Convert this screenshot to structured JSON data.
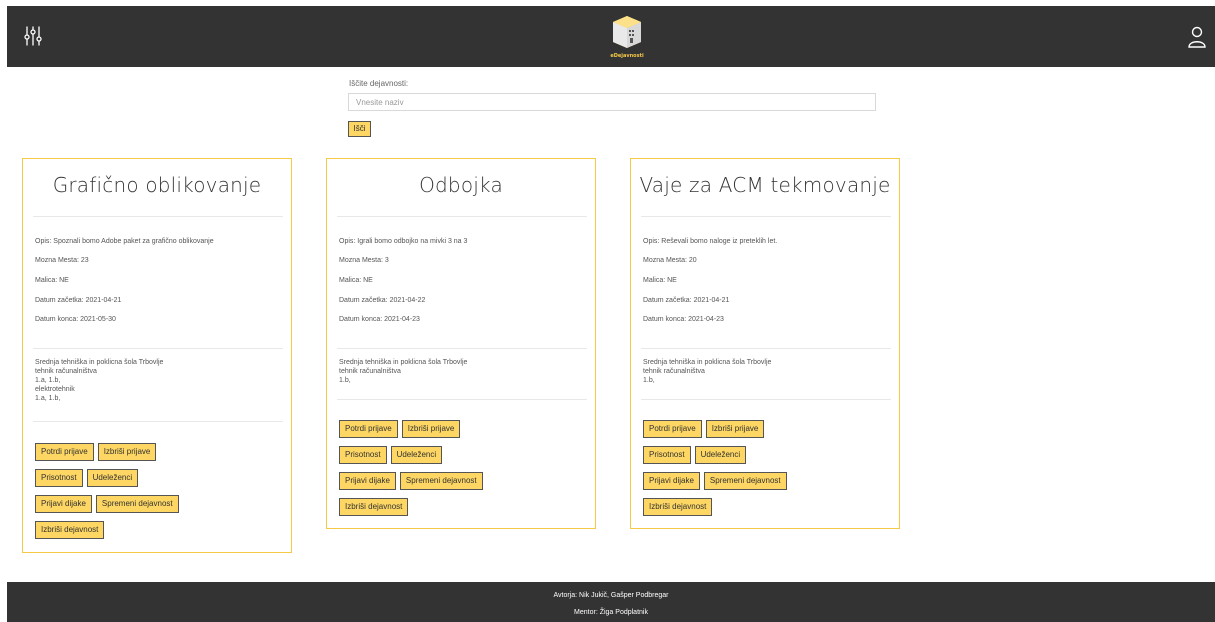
{
  "header": {
    "logo_text": "eDejavnosti",
    "colors": {
      "bar": "#333333",
      "accent": "#f7c948"
    },
    "icons": {
      "left": "sliders-icon",
      "right": "user-icon"
    }
  },
  "search": {
    "label": "Iščite dejavnosti:",
    "placeholder": "Vnesite naziv",
    "button": "Išči"
  },
  "cards": [
    {
      "title": "Grafično oblikovanje",
      "opis": "Opis: Spoznali bomo Adobe paket za grafično oblikovanje",
      "mesta": "Mozna Mesta: 23",
      "malica": "Malica: NE",
      "zacetek": "Datum začetka: 2021-04-21",
      "konec": "Datum konca: 2021-05-30",
      "school": [
        "Srednja tehniška in poklicna šola Trbovlje",
        "tehnik računalništva",
        "1.a, 1.b,",
        "elektrotehnik",
        "1.a, 1.b,"
      ]
    },
    {
      "title": "Odbojka",
      "opis": "Opis: Igrali bomo odbojko na mivki 3 na 3",
      "mesta": "Mozna Mesta: 3",
      "malica": "Malica: NE",
      "zacetek": "Datum začetka: 2021-04-22",
      "konec": "Datum konca: 2021-04-23",
      "school": [
        "Srednja tehniška in poklicna šola Trbovlje",
        "tehnik računalništva",
        "1.b,"
      ]
    },
    {
      "title": "Vaje za ACM tekmovanje",
      "opis": "Opis: Reševali bomo naloge iz preteklih let.",
      "mesta": "Mozna Mesta: 20",
      "malica": "Malica: NE",
      "zacetek": "Datum začetka: 2021-04-21",
      "konec": "Datum konca: 2021-04-23",
      "school": [
        "Srednja tehniška in poklicna šola Trbovlje",
        "tehnik računalništva",
        "1.b,"
      ]
    }
  ],
  "buttons": {
    "potrdi": "Potrdi prijave",
    "izbrisi_prijave": "Izbriši prijave",
    "prisotnost": "Prisotnost",
    "udelezenci": "Udeleženci",
    "prijavi": "Prijavi dijake",
    "spremeni": "Spremeni dejavnost",
    "izbrisi_dejavnost": "Izbriši dejavnost"
  },
  "footer": {
    "authors": "Avtorja: Nik Jukič, Gašper Podbregar",
    "mentor": "Mentor: Žiga Podplatnik"
  }
}
